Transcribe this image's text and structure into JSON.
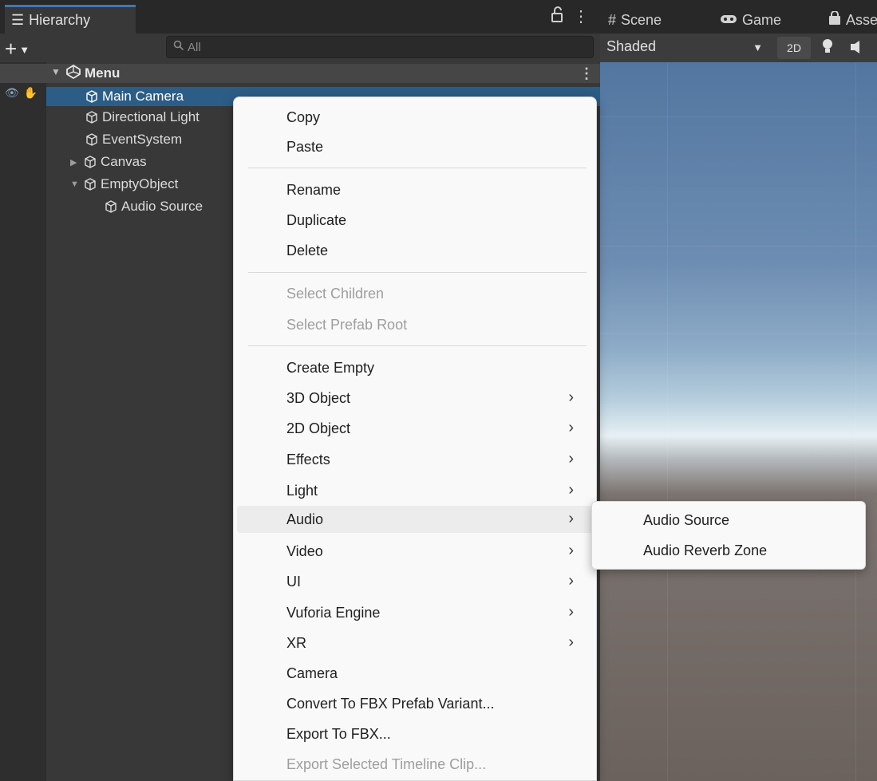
{
  "hierarchy": {
    "tab_label": "Hierarchy",
    "search_placeholder": "All",
    "scene_name": "Menu",
    "items": [
      {
        "label": "Main Camera"
      },
      {
        "label": "Directional Light"
      },
      {
        "label": "EventSystem"
      },
      {
        "label": "Canvas"
      },
      {
        "label": "EmptyObject"
      },
      {
        "label": "Audio Source"
      }
    ]
  },
  "scene_panel": {
    "tabs": [
      {
        "label": "Scene"
      },
      {
        "label": "Game"
      },
      {
        "label": "Asse"
      }
    ],
    "shading_mode": "Shaded",
    "mode_2d_label": "2D"
  },
  "context_menu": {
    "items": {
      "copy": "Copy",
      "paste": "Paste",
      "rename": "Rename",
      "duplicate": "Duplicate",
      "delete": "Delete",
      "select_children": "Select Children",
      "select_prefab_root": "Select Prefab Root",
      "create_empty": "Create Empty",
      "object_3d": "3D Object",
      "object_2d": "2D Object",
      "effects": "Effects",
      "light": "Light",
      "audio": "Audio",
      "video": "Video",
      "ui": "UI",
      "vuforia": "Vuforia Engine",
      "xr": "XR",
      "camera": "Camera",
      "convert_fbx": "Convert To FBX Prefab Variant...",
      "export_fbx": "Export To FBX...",
      "export_timeline": "Export Selected Timeline Clip..."
    }
  },
  "audio_submenu": {
    "items": {
      "audio_source": "Audio Source",
      "audio_reverb_zone": "Audio Reverb Zone"
    }
  },
  "colors": {
    "selection": "#2c5d87",
    "panel_bg": "#383838",
    "menu_bg": "#f9f9f9",
    "accent": "#3a79bb"
  }
}
